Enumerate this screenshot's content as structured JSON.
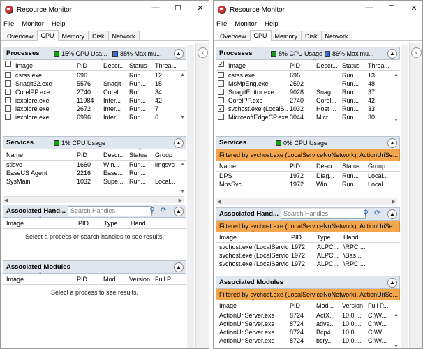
{
  "window_title": "Resource Monitor",
  "controls": {
    "minimize": "—",
    "maximize": "☐",
    "close": "✕"
  },
  "menu": [
    "File",
    "Monitor",
    "Help"
  ],
  "tabs": [
    "Overview",
    "CPU",
    "Memory",
    "Disk",
    "Network"
  ],
  "active_tab": "CPU",
  "left": {
    "processes": {
      "title": "Processes",
      "cpu_usage": "15% CPU Usa...",
      "max_freq": "88% Maximu...",
      "columns": [
        "Image",
        "PID",
        "Descr...",
        "Status",
        "Threa..."
      ],
      "rows": [
        [
          "csrss.exe",
          "696",
          "",
          "Run...",
          "12"
        ],
        [
          "Snagit32.exe",
          "5576",
          "Snagit",
          "Run...",
          "15"
        ],
        [
          "CorelPP.exe",
          "2740",
          "Corel...",
          "Run...",
          "34"
        ],
        [
          "iexplore.exe",
          "11984",
          "Inter...",
          "Run...",
          "42"
        ],
        [
          "iexplore.exe",
          "2672",
          "Inter...",
          "Run...",
          "7"
        ],
        [
          "iexplore.exe",
          "6996",
          "Inter...",
          "Run...",
          "6"
        ]
      ]
    },
    "services": {
      "title": "Services",
      "cpu_usage": "1% CPU Usage",
      "columns": [
        "Name",
        "PID",
        "Descr...",
        "Status",
        "Group"
      ],
      "rows": [
        [
          "stisvc",
          "1660",
          "Win...",
          "Run...",
          "imgsvc"
        ],
        [
          "EaseUS Agent",
          "2216",
          "Ease...",
          "Run...",
          ""
        ],
        [
          "SysMain",
          "1032",
          "Supe...",
          "Run...",
          "Local..."
        ]
      ]
    },
    "handles": {
      "title": "Associated Hand...",
      "search_placeholder": "Search Handles",
      "columns": [
        "Image",
        "PID",
        "Type",
        "Hand..."
      ],
      "message": "Select a process or search handles to see results."
    },
    "modules": {
      "title": "Associated Modules",
      "columns": [
        "Image",
        "PID",
        "Mod...",
        "Version",
        "Full P..."
      ],
      "message": "Select a process to see results."
    }
  },
  "right": {
    "processes": {
      "title": "Processes",
      "cpu_usage": "8% CPU Usage",
      "max_freq": "86% Maximu...",
      "columns": [
        "Image",
        "PID",
        "Descr...",
        "Status",
        "Threa..."
      ],
      "rows": [
        [
          "csrss.exe",
          "696",
          "",
          "Run...",
          "13"
        ],
        [
          "MsMpEng.exe",
          "2592",
          "",
          "Run...",
          "48"
        ],
        [
          "SnagitEditor.exe",
          "9028",
          "Snag...",
          "Run...",
          "37"
        ],
        [
          "CorelPP.exe",
          "2740",
          "Corel...",
          "Run...",
          "42"
        ],
        [
          "svchost.exe (LocalS...",
          "1032",
          "Host ...",
          "Run...",
          "33"
        ],
        [
          "MicrosoftEdgeCP.exe",
          "3044",
          "Micr...",
          "Run...",
          "30"
        ]
      ],
      "checked_row": 4
    },
    "services": {
      "title": "Services",
      "cpu_usage": "0% CPU Usage",
      "filter": "Filtered by svchost.exe (LocalServiceNoNetwork), ActionUriSe...",
      "columns": [
        "Name",
        "PID",
        "Descr...",
        "Status",
        "Group"
      ],
      "rows": [
        [
          "DPS",
          "1972",
          "Diag...",
          "Run...",
          "Local..."
        ],
        [
          "MpsSvc",
          "1972",
          "Win...",
          "Run...",
          "Local..."
        ]
      ]
    },
    "handles": {
      "title": "Associated Hand...",
      "search_placeholder": "Search Handles",
      "filter": "Filtered by svchost.exe (LocalServiceNoNetwork), ActionUriSe...",
      "columns": [
        "Image",
        "PID",
        "Type",
        "Hand..."
      ],
      "rows": [
        [
          "svchost.exe (LocalService...",
          "1972",
          "ALPC...",
          "\\RPC ..."
        ],
        [
          "svchost.exe (LocalService...",
          "1972",
          "ALPC...",
          "\\Bas..."
        ],
        [
          "svchost.exe (LocalService...",
          "1972",
          "ALPC...",
          "\\RPC ..."
        ]
      ]
    },
    "modules": {
      "title": "Associated Modules",
      "filter": "Filtered by svchost.exe (LocalServiceNoNetwork), ActionUriSe...",
      "columns": [
        "Image",
        "PID",
        "Mod...",
        "Version",
        "Full P..."
      ],
      "rows": [
        [
          "ActionUriServer.exe",
          "8724",
          "ActX...",
          "10.0....",
          "C:\\W..."
        ],
        [
          "ActionUriServer.exe",
          "8724",
          "adva...",
          "10.0....",
          "C:\\W..."
        ],
        [
          "ActionUriServer.exe",
          "8724",
          "Bcp4...",
          "10.0....",
          "C:\\W..."
        ],
        [
          "ActionUriServer.exe",
          "8724",
          "bcry...",
          "10.0....",
          "C:\\W..."
        ]
      ]
    }
  },
  "colors": {
    "header_bg": "#dfe6ed",
    "filter_bg": "#f4a64d",
    "cpu_green": "#1a9e1a",
    "freq_blue": "#3c6fd6"
  }
}
